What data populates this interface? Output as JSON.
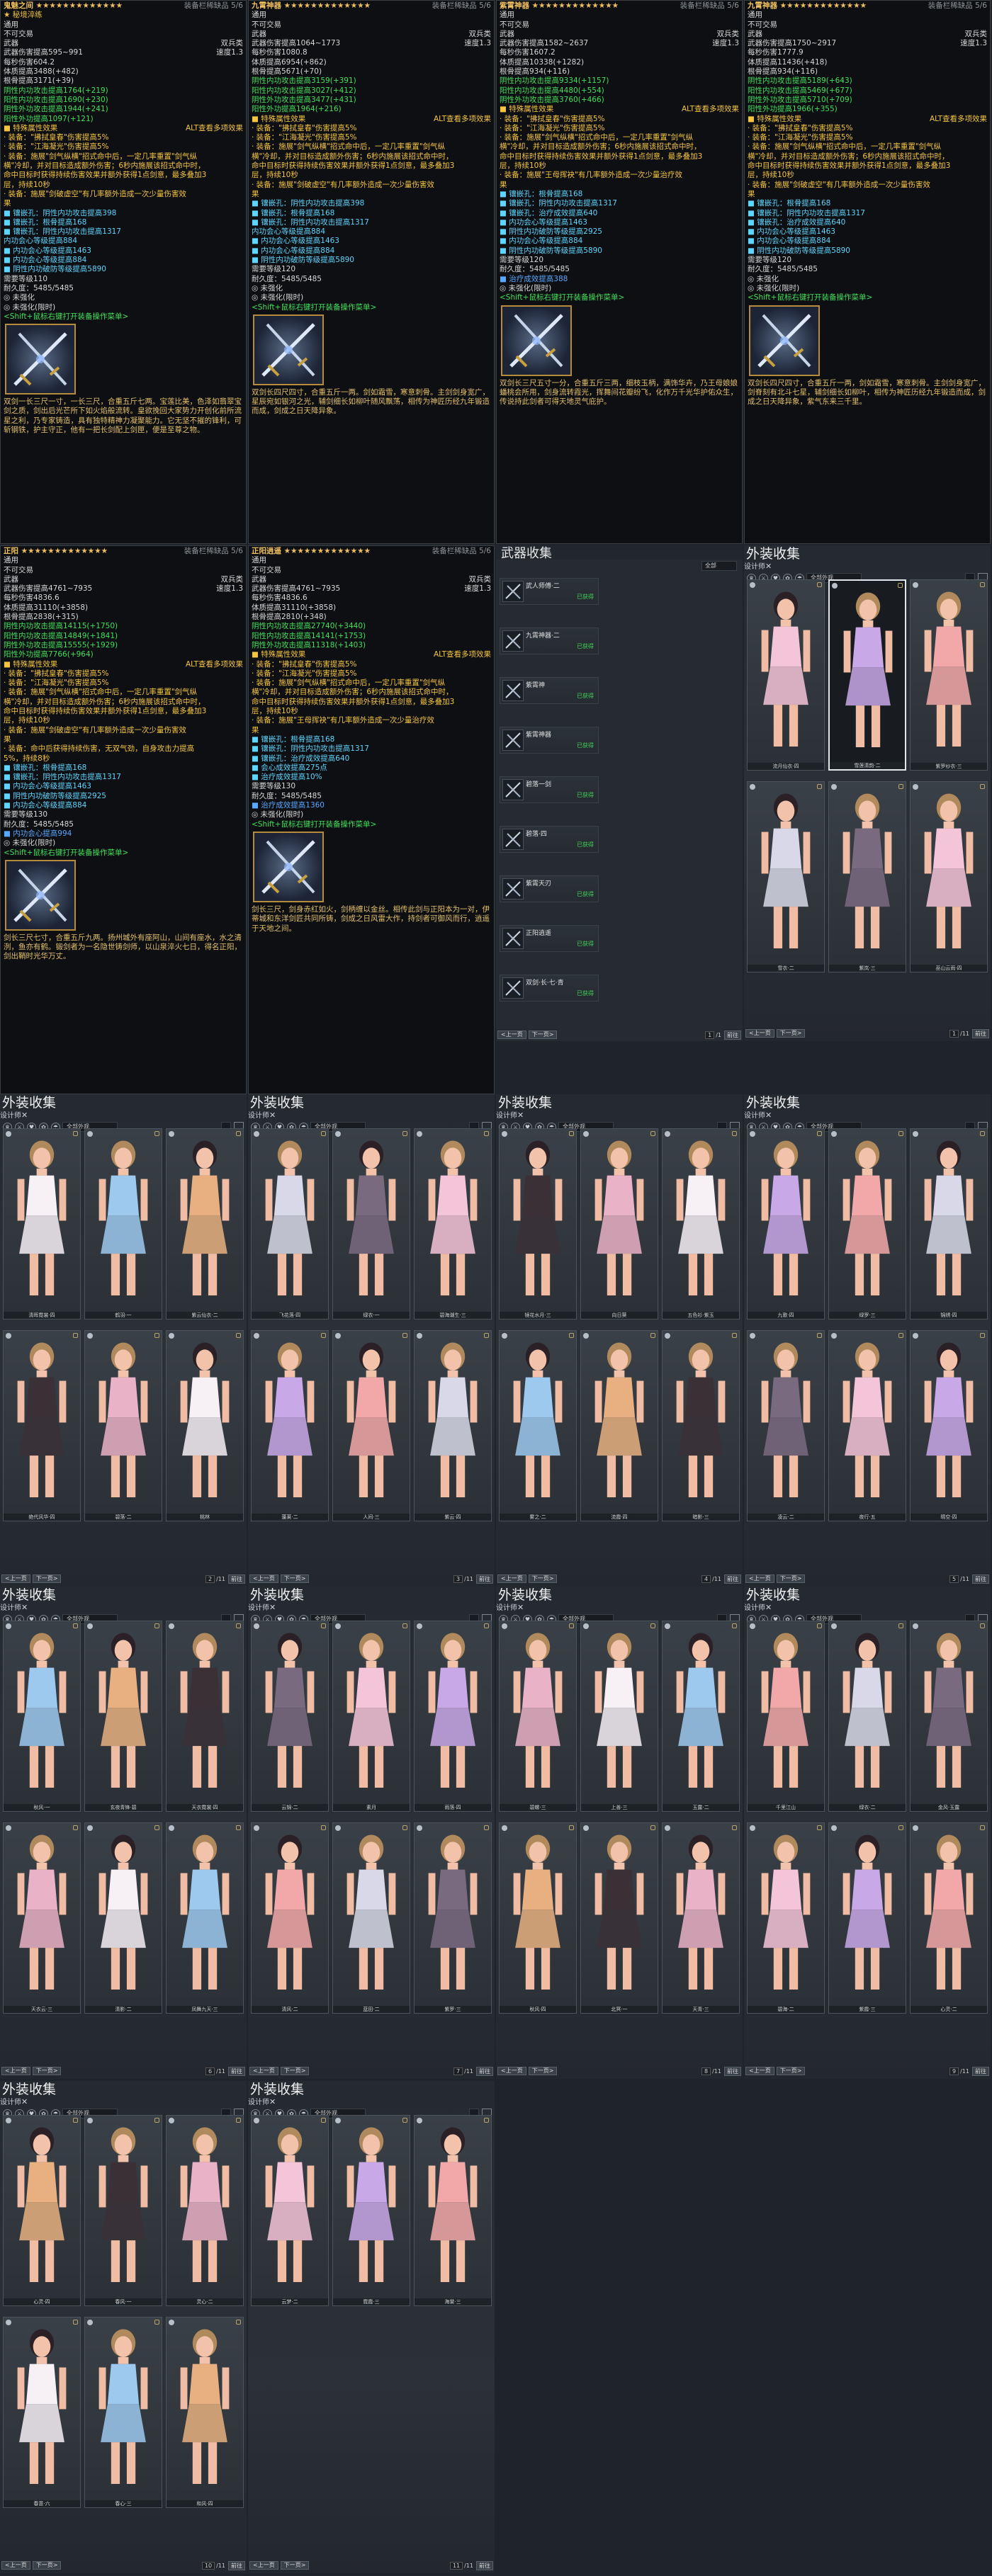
{
  "tooltips": [
    {
      "title": "鬼魅之间 ★★★★★★★★★★★★★",
      "stars": "★★★★★★★★★★★★",
      "right_tag": "装备栏稀缺品 5/6",
      "lines": [
        {
          "t": "★ 秘境淬练",
          "c": "gold"
        },
        {
          "t": "通用",
          "c": ""
        },
        {
          "t": "不可交易",
          "c": ""
        },
        {
          "l": "武器",
          "r": "双兵类",
          "c": ""
        },
        {
          "l": "武器伤害提高595~991",
          "r": "速度1.3",
          "c": ""
        },
        {
          "t": "每秒伤害604.2",
          "c": ""
        },
        {
          "t": "体质提高3488(+482)",
          "c": ""
        },
        {
          "t": "根骨提高3171(+39)",
          "c": ""
        },
        {
          "t": "阴性内功攻击提高1764(+219)",
          "c": "green"
        },
        {
          "t": "阳性内功攻击提高1690(+230)",
          "c": "green"
        },
        {
          "t": "阴性外功攻击提高1944(+241)",
          "c": "green"
        },
        {
          "t": "阳性外功提高1097(+121)",
          "c": "green"
        },
        {
          "l": "■ 特殊属性效果",
          "r": "ALT查看多项效果",
          "c": "gold"
        },
        {
          "t": "· 装备：\"拂拭皇春\"伤害提高5%",
          "c": "gold"
        },
        {
          "t": "· 装备：\"江海凝光\"伤害提高5%",
          "c": "gold"
        },
        {
          "t": "· 装备：施展\"剑气纵横\"招式命中后，一定几率重置\"剑气纵",
          "c": "gold"
        },
        {
          "t": "横\"冷却，并对目标造成额外伤害；6秒内施展该招式命中时，",
          "c": "gold"
        },
        {
          "t": "命中目标时获得持续伤害效果并额外获得1点剑意，最多叠加3",
          "c": "gold"
        },
        {
          "t": "层，持续10秒",
          "c": "gold"
        },
        {
          "t": "· 装备：施展\"剑破虚空\"有几率额外造成一次少量伤害效",
          "c": "gold"
        },
        {
          "t": "果",
          "c": "gold"
        },
        {
          "t": "■ 镶嵌孔：阴性内功攻击提高398",
          "c": "cyan"
        },
        {
          "t": "■ 镶嵌孔：根骨提高168",
          "c": "cyan"
        },
        {
          "t": "■ 镶嵌孔：阴性内功攻击提高1317",
          "c": "cyan"
        },
        {
          "t": "  内功会心等级提高884",
          "c": "cyan"
        },
        {
          "t": "■ 内功会心等级提高1463",
          "c": "cyan"
        },
        {
          "t": "■ 内功会心等级提高884",
          "c": "cyan"
        },
        {
          "t": "■ 阴性内功破防等级提高5890",
          "c": "cyan"
        },
        {
          "t": "需要等级110",
          "c": ""
        },
        {
          "t": "耐久度：5485/5485",
          "c": ""
        },
        {
          "t": "◎ 未强化",
          "c": ""
        },
        {
          "t": "◎ 未强化(限时)",
          "c": ""
        },
        {
          "t": "<Shift+鼠标右键打开装备操作菜单>",
          "c": "green"
        }
      ],
      "lore": "双剑一长三尺一寸，一长三尺，合重五斤七两。宝莲比美，色泽如翡翠宝剑之质，剑出后光芒所下如火焰般流转。皇欲挽回大家势力开创化前所流星之利，乃专家铸造，具有独特精神力凝聚能力。它无坚不摧的锋利，可斩钢铁，护主守正，他有一把长剑配上剑匣，便是至尊之物。"
    },
    {
      "title": "九霄神器 ★★★★★★★★★★★★★",
      "stars": "★★★★★★★★★★★★",
      "right_tag": "装备栏稀缺品 5/6",
      "lines": [
        {
          "t": "通用",
          "c": ""
        },
        {
          "t": "不可交易",
          "c": ""
        },
        {
          "l": "武器",
          "r": "双兵类",
          "c": ""
        },
        {
          "l": "武器伤害提高1064~1773",
          "r": "速度1.3",
          "c": ""
        },
        {
          "t": "每秒伤害1080.8",
          "c": ""
        },
        {
          "t": "体质提高6954(+862)",
          "c": ""
        },
        {
          "t": "根骨提高5671(+70)",
          "c": ""
        },
        {
          "t": "阴性内功攻击提高3159(+391)",
          "c": "green"
        },
        {
          "t": "阳性内功攻击提高3027(+412)",
          "c": "green"
        },
        {
          "t": "阴性外功攻击提高3477(+431)",
          "c": "green"
        },
        {
          "t": "阳性外功提高1964(+216)",
          "c": "green"
        },
        {
          "l": "■ 特殊属性效果",
          "r": "ALT查看多项效果",
          "c": "gold"
        },
        {
          "t": "· 装备：\"拂拭皇春\"伤害提高5%",
          "c": "gold"
        },
        {
          "t": "· 装备：\"江海凝光\"伤害提高5%",
          "c": "gold"
        },
        {
          "t": "· 装备：施展\"剑气纵横\"招式命中后，一定几率重置\"剑气纵",
          "c": "gold"
        },
        {
          "t": "横\"冷却，并对目标造成额外伤害；6秒内施展该招式命中时，",
          "c": "gold"
        },
        {
          "t": "命中目标时获得持续伤害效果并额外获得1点剑意，最多叠加3",
          "c": "gold"
        },
        {
          "t": "层，持续10秒",
          "c": "gold"
        },
        {
          "t": "· 装备：施展\"剑破虚空\"有几率额外造成一次少量伤害效",
          "c": "gold"
        },
        {
          "t": "果",
          "c": "gold"
        },
        {
          "t": "■ 镶嵌孔：阴性内功攻击提高398",
          "c": "cyan"
        },
        {
          "t": "■ 镶嵌孔：根骨提高168",
          "c": "cyan"
        },
        {
          "t": "■ 镶嵌孔：阴性内功攻击提高1317",
          "c": "cyan"
        },
        {
          "t": "  内功会心等级提高884",
          "c": "cyan"
        },
        {
          "t": "■ 内功会心等级提高1463",
          "c": "cyan"
        },
        {
          "t": "■ 内功会心等级提高884",
          "c": "cyan"
        },
        {
          "t": "■ 阴性内功破防等级提高5890",
          "c": "cyan"
        },
        {
          "t": "需要等级120",
          "c": ""
        },
        {
          "t": "耐久度：5485/5485",
          "c": ""
        },
        {
          "t": "◎ 未强化",
          "c": ""
        },
        {
          "t": "◎ 未强化(限时)",
          "c": ""
        },
        {
          "t": "<Shift+鼠标右键打开装备操作菜单>",
          "c": "green"
        }
      ],
      "lore": "双剑长四尺四寸，合重五斤一两。剑如霜雪，寒意刺骨。主剑剑身宽广，星辰宛如银河之光，辅剑细长如柳叶随风飘荡，相传为神匠历经九年锻造而成，剑成之日天降异象。"
    },
    {
      "title": "紫霄神器 ★★★★★★★★★★★★★",
      "stars": "★★★★★★★★★★★★",
      "right_tag": "装备栏稀缺品 5/6",
      "lines": [
        {
          "t": "通用",
          "c": ""
        },
        {
          "t": "不可交易",
          "c": ""
        },
        {
          "l": "武器",
          "r": "双兵类",
          "c": ""
        },
        {
          "l": "武器伤害提高1582~2637",
          "r": "速度1.3",
          "c": ""
        },
        {
          "t": "每秒伤害1607.2",
          "c": ""
        },
        {
          "t": "体质提高10338(+1282)",
          "c": ""
        },
        {
          "t": "根骨提高934(+116)",
          "c": ""
        },
        {
          "t": "阴性内功攻击提高9334(+1157)",
          "c": "green"
        },
        {
          "t": "阳性内功攻击提高4480(+554)",
          "c": "green"
        },
        {
          "t": "阴性外功攻击提高3760(+466)",
          "c": "green"
        },
        {
          "l": "■ 特殊属性效果",
          "r": "ALT查看多项效果",
          "c": "gold"
        },
        {
          "t": "· 装备：\"拂拭皇春\"伤害提高5%",
          "c": "gold"
        },
        {
          "t": "· 装备：\"江海凝光\"伤害提高5%",
          "c": "gold"
        },
        {
          "t": "· 装备：施展\"剑气纵横\"招式命中后，一定几率重置\"剑气纵",
          "c": "gold"
        },
        {
          "t": "横\"冷却，并对目标造成额外伤害；6秒内施展该招式命中时，",
          "c": "gold"
        },
        {
          "t": "命中目标时获得持续伤害效果并额外获得1点剑意，最多叠加3",
          "c": "gold"
        },
        {
          "t": "层，持续10秒",
          "c": "gold"
        },
        {
          "t": "· 装备：施展\"王母挥袂\"有几率额外造成一次少量治疗效",
          "c": "gold"
        },
        {
          "t": "果",
          "c": "gold"
        },
        {
          "t": "■ 镶嵌孔：根骨提高168",
          "c": "cyan"
        },
        {
          "t": "■ 镶嵌孔：阴性内功攻击提高1317",
          "c": "cyan"
        },
        {
          "t": "■ 镶嵌孔：治疗成效提高640",
          "c": "cyan"
        },
        {
          "t": "■ 内功会心等级提高1463",
          "c": "cyan"
        },
        {
          "t": "■ 阴性内功破防等级提高2925",
          "c": "cyan"
        },
        {
          "t": "■ 内功会心等级提高884",
          "c": "cyan"
        },
        {
          "t": "■ 阴性内功破防等级提高5890",
          "c": "cyan"
        },
        {
          "t": "需要等级120",
          "c": ""
        },
        {
          "t": "耐久度：5485/5485",
          "c": ""
        },
        {
          "t": "■ 治疗成效提高388",
          "c": "blue"
        },
        {
          "t": "◎ 未强化(限时)",
          "c": ""
        },
        {
          "t": "<Shift+鼠标右键打开装备操作菜单>",
          "c": "green"
        }
      ],
      "lore": "双剑长三尺五寸一分，合重五斤三两，细枝玉柄，满饰华卉，乃王母娘娘蟠桃会所用，剑身流转霞光，挥舞间花瓣纷飞，化作万千光华护佑众生，传说持此剑者可得天地灵气庇护。"
    },
    {
      "title": "九霄神器 ★★★★★★★★★★★★★",
      "stars": "★★★★★★★★★★★★",
      "right_tag": "装备栏稀缺品 5/6",
      "lines": [
        {
          "t": "通用",
          "c": ""
        },
        {
          "t": "不可交易",
          "c": ""
        },
        {
          "l": "武器",
          "r": "双兵类",
          "c": ""
        },
        {
          "l": "武器伤害提高1750~2917",
          "r": "速度1.3",
          "c": ""
        },
        {
          "t": "每秒伤害1777.9",
          "c": ""
        },
        {
          "t": "体质提高11436(+418)",
          "c": ""
        },
        {
          "t": "根骨提高934(+116)",
          "c": ""
        },
        {
          "t": "阴性内功攻击提高5189(+643)",
          "c": "green"
        },
        {
          "t": "阳性内功攻击提高5469(+677)",
          "c": "green"
        },
        {
          "t": "阴性外功攻击提高5710(+709)",
          "c": "green"
        },
        {
          "t": "阳性外功提高1966(+355)",
          "c": "green"
        },
        {
          "l": "■ 特殊属性效果",
          "r": "ALT查看多项效果",
          "c": "gold"
        },
        {
          "t": "· 装备：\"拂拭皇春\"伤害提高5%",
          "c": "gold"
        },
        {
          "t": "· 装备：\"江海凝光\"伤害提高5%",
          "c": "gold"
        },
        {
          "t": "· 装备：施展\"剑气纵横\"招式命中后，一定几率重置\"剑气纵",
          "c": "gold"
        },
        {
          "t": "横\"冷却，并对目标造成额外伤害；6秒内施展该招式命中时，",
          "c": "gold"
        },
        {
          "t": "命中目标时获得持续伤害效果并额外获得1点剑意，最多叠加3",
          "c": "gold"
        },
        {
          "t": "层，持续10秒",
          "c": "gold"
        },
        {
          "t": "· 装备：施展\"剑破虚空\"有几率额外造成一次少量伤害效",
          "c": "gold"
        },
        {
          "t": "果",
          "c": "gold"
        },
        {
          "t": "■ 镶嵌孔：根骨提高168",
          "c": "cyan"
        },
        {
          "t": "■ 镶嵌孔：阴性内功攻击提高1317",
          "c": "cyan"
        },
        {
          "t": "■ 镶嵌孔：治疗成效提高640",
          "c": "cyan"
        },
        {
          "t": "■ 内功会心等级提高1463",
          "c": "cyan"
        },
        {
          "t": "■ 内功会心等级提高884",
          "c": "cyan"
        },
        {
          "t": "■ 阴性内功破防等级提高5890",
          "c": "cyan"
        },
        {
          "t": "需要等级120",
          "c": ""
        },
        {
          "t": "耐久度：5485/5485",
          "c": ""
        },
        {
          "t": "◎ 未强化",
          "c": ""
        },
        {
          "t": "◎ 未强化(限时)",
          "c": ""
        },
        {
          "t": "<Shift+鼠标右键打开装备操作菜单>",
          "c": "green"
        }
      ],
      "lore": "双剑长四尺四寸，合重五斤一两，剑如霜雪，寒意刺骨。主剑剑身宽广，剑脊刻有北斗七星，辅剑细长如柳叶，相传为神匠历经九年锻造而成，剑成之日天降异象，紫气东来三千里。"
    },
    {
      "title": "正阳 ★★★★★★★★★★★★★",
      "stars": "★★★★★★★★★★★★",
      "right_tag": "装备栏稀缺品 5/6",
      "lines": [
        {
          "t": "通用",
          "c": ""
        },
        {
          "t": "不可交易",
          "c": ""
        },
        {
          "l": "武器",
          "r": "双兵类",
          "c": ""
        },
        {
          "l": "武器伤害提高4761~7935",
          "r": "速度1.3",
          "c": ""
        },
        {
          "t": "每秒伤害4836.6",
          "c": ""
        },
        {
          "t": "体质提高31110(+3858)",
          "c": ""
        },
        {
          "t": "根骨提高2838(+315)",
          "c": ""
        },
        {
          "t": "阴性内功攻击提高14115(+1750)",
          "c": "green"
        },
        {
          "t": "阳性内功攻击提高14849(+1841)",
          "c": "green"
        },
        {
          "t": "阴性外功攻击提高15555(+1929)",
          "c": "green"
        },
        {
          "t": "阳性外功提高7766(+964)",
          "c": "green"
        },
        {
          "l": "■ 特殊属性效果",
          "r": "ALT查看多项效果",
          "c": "gold"
        },
        {
          "t": "· 装备：\"拂拭皇春\"伤害提高5%",
          "c": "gold"
        },
        {
          "t": "· 装备：\"江海凝光\"伤害提高5%",
          "c": "gold"
        },
        {
          "t": "· 装备：施展\"剑气纵横\"招式命中后，一定几率重置\"剑气纵",
          "c": "gold"
        },
        {
          "t": "横\"冷却，并对目标造成额外伤害；6秒内施展该招式命中时，",
          "c": "gold"
        },
        {
          "t": "命中目标时获得持续伤害效果并额外获得1点剑意，最多叠加3",
          "c": "gold"
        },
        {
          "t": "层，持续10秒",
          "c": "gold"
        },
        {
          "t": "· 装备：施展\"剑破虚空\"有几率额外造成一次少量伤害效",
          "c": "gold"
        },
        {
          "t": "果",
          "c": "gold"
        },
        {
          "t": "· 装备：命中后获得持续伤害，无双气劲，自身攻击力提高",
          "c": "gold"
        },
        {
          "t": "5%，持续8秒",
          "c": "gold"
        },
        {
          "t": "■ 镶嵌孔：根骨提高168",
          "c": "cyan"
        },
        {
          "t": "■ 镶嵌孔：阴性内功攻击提高1317",
          "c": "cyan"
        },
        {
          "t": "■ 内功会心等级提高1463",
          "c": "cyan"
        },
        {
          "t": "■ 阴性内功破防等级提高2925",
          "c": "cyan"
        },
        {
          "t": "■ 内功会心等级提高884",
          "c": "cyan"
        },
        {
          "t": "需要等级130",
          "c": ""
        },
        {
          "t": "耐久度：5485/5485",
          "c": ""
        },
        {
          "t": "■ 内功会心提高994",
          "c": "blue"
        },
        {
          "t": "◎ 未强化(限时)",
          "c": ""
        },
        {
          "t": "<Shift+鼠标右键打开装备操作菜单>",
          "c": "green"
        }
      ],
      "lore": "剑长三尺七寸，合重五斤九两。扬州城外有座阿山，山间有座水，水之清洌，鱼亦有鹤。锻剑者为一名隐世铸剑师，以山泉淬火七日，得名正阳，剑出鞘时光华万丈。"
    },
    {
      "title": "正阳逍遥 ★★★★★★★★★★★★★",
      "stars": "★★★★★★★★★★★★",
      "right_tag": "装备栏稀缺品 5/6",
      "lines": [
        {
          "t": "通用",
          "c": ""
        },
        {
          "t": "不可交易",
          "c": ""
        },
        {
          "l": "武器",
          "r": "双兵类",
          "c": ""
        },
        {
          "l": "武器伤害提高4761~7935",
          "r": "速度1.3",
          "c": ""
        },
        {
          "t": "每秒伤害4836.6",
          "c": ""
        },
        {
          "t": "体质提高31110(+3858)",
          "c": ""
        },
        {
          "t": "根骨提高2810(+348)",
          "c": ""
        },
        {
          "t": "阴性内功攻击提高27740(+3440)",
          "c": "green"
        },
        {
          "t": "阳性内功攻击提高14141(+1753)",
          "c": "green"
        },
        {
          "t": "阴性外功攻击提高11318(+1403)",
          "c": "green"
        },
        {
          "l": "■ 特殊属性效果",
          "r": "ALT查看多项效果",
          "c": "gold"
        },
        {
          "t": "· 装备：\"拂拭皇春\"伤害提高5%",
          "c": "gold"
        },
        {
          "t": "· 装备：\"江海凝光\"伤害提高5%",
          "c": "gold"
        },
        {
          "t": "· 装备：施展\"剑气纵横\"招式命中后，一定几率重置\"剑气纵",
          "c": "gold"
        },
        {
          "t": "横\"冷却，并对目标造成额外伤害；6秒内施展该招式命中时，",
          "c": "gold"
        },
        {
          "t": "命中目标时获得持续伤害效果并额外获得1点剑意，最多叠加3",
          "c": "gold"
        },
        {
          "t": "层，持续10秒",
          "c": "gold"
        },
        {
          "t": "· 装备：施展\"王母挥袂\"有几率额外造成一次少量治疗效",
          "c": "gold"
        },
        {
          "t": "果",
          "c": "gold"
        },
        {
          "t": "■ 镶嵌孔：根骨提高168",
          "c": "cyan"
        },
        {
          "t": "■ 镶嵌孔：阴性内功攻击提高1317",
          "c": "cyan"
        },
        {
          "t": "■ 镶嵌孔：治疗成效提高640",
          "c": "cyan"
        },
        {
          "t": "■ 会心成效提高275点",
          "c": "cyan"
        },
        {
          "t": "■ 治疗成效提高10%",
          "c": "cyan"
        },
        {
          "t": "需要等级130",
          "c": ""
        },
        {
          "t": "耐久度：5485/5485",
          "c": ""
        },
        {
          "t": "■ 治疗成效提高1360",
          "c": "blue"
        },
        {
          "t": "◎ 未强化(限时)",
          "c": ""
        },
        {
          "t": "<Shift+鼠标右键打开装备操作菜单>",
          "c": "green"
        }
      ],
      "lore": "剑长三尺，剑身赤红如火，剑柄缠以金丝。相传此剑与正阳本为一对，伊蒂城和东洋剑匠共同所铸，剑成之日风雷大作，持剑者可御风而行，逍遥于天地之间。"
    }
  ],
  "weapon_list": {
    "title": "武器收集",
    "filter": "全部",
    "items": [
      {
        "name": "武人师傅·二",
        "tag": "已获得"
      },
      {
        "name": "九霄神器·二",
        "tag": "已获得"
      },
      {
        "name": "紫霄神",
        "tag": "已获得"
      },
      {
        "name": "紫霄神器",
        "tag": "已获得"
      },
      {
        "name": "碧落一剑",
        "tag": "已获得"
      },
      {
        "name": "碧落·四",
        "tag": "已获得"
      },
      {
        "name": "紫霄天刃",
        "tag": "已获得"
      },
      {
        "name": "正阳逍遥",
        "tag": "已获得"
      },
      {
        "name": "双剑·长·七·青",
        "tag": "已获得"
      }
    ],
    "prev": "<上一页",
    "next": "下一页>",
    "page": "1",
    "total": "/1",
    "confirm": "前往"
  },
  "collections": [
    {
      "title": "外装收集",
      "filter": "全部外观",
      "vip": "设计师",
      "page": "1",
      "total": "/11",
      "cards": [
        "流月仙衣·四",
        "雪莲清韵·二",
        "紫罗纱衣·三",
        "雪衣·二",
        "紫岚·三",
        "巫山云雨·四"
      ]
    },
    {
      "title": "外装收集",
      "filter": "全部外观",
      "vip": "设计师",
      "page": "2",
      "total": "/11",
      "cards": [
        "清晖霓裳·四",
        "鹤羽·一",
        "紫云仙衣·二",
        "绝代风华·四",
        "碧落·二",
        "桃林"
      ]
    },
    {
      "title": "外装收集",
      "filter": "全部外观",
      "vip": "设计师",
      "page": "3",
      "total": "/11",
      "cards": [
        "飞花落·四",
        "绿衣·一",
        "碧海潮生·三",
        "蓬莱·二",
        "人间·三",
        "紫云·四"
      ]
    },
    {
      "title": "外装收集",
      "filter": "全部外观",
      "vip": "设计师",
      "page": "4",
      "total": "/11",
      "cards": [
        "镜花水月·三",
        "向日葵",
        "五色衫·紫玉",
        "雾之·二",
        "流霞·四",
        "暗影·三"
      ]
    },
    {
      "title": "外装收集",
      "filter": "全部外观",
      "vip": "设计师",
      "page": "5",
      "total": "/11",
      "cards": [
        "九歌·四",
        "绿罗·三",
        "锦绣·四",
        "凌云·二",
        "夜行·五",
        "晴空·四"
      ]
    },
    {
      "title": "外装收集",
      "filter": "全部外观",
      "vip": "设计师",
      "page": "6",
      "total": "/11",
      "cards": [
        "秋风·一",
        "玄夜青锋·碧",
        "天衣霓裳·四",
        "天衣云·三",
        "清影·二",
        "凤舞九天·三"
      ]
    },
    {
      "title": "外装收集",
      "filter": "全部外观",
      "vip": "设计师",
      "page": "7",
      "total": "/11",
      "cards": [
        "云锦·二",
        "素月",
        "雨落·四",
        "清风·二",
        "蓝田·二",
        "紫罗·三"
      ]
    },
    {
      "title": "外装收集",
      "filter": "全部外观",
      "vip": "设计师",
      "page": "8",
      "total": "/11",
      "cards": [
        "碧螺·三",
        "上善·三",
        "玉露·二",
        "秋风·四",
        "北冥·一",
        "天青·三"
      ]
    },
    {
      "title": "外装收集",
      "filter": "全部外观",
      "vip": "设计师",
      "page": "9",
      "total": "/11",
      "cards": [
        "千里江山",
        "绿衣·二",
        "金风·玉露",
        "碧海·二",
        "紫霞·三",
        "心灵·二"
      ]
    },
    {
      "title": "外装收集",
      "filter": "全部外观",
      "vip": "设计师",
      "page": "10",
      "total": "/11",
      "cards": [
        "心灵·四",
        "春风·一",
        "灵心·二",
        "春意·六",
        "春心·三",
        "和风·四"
      ]
    },
    {
      "title": "外装收集",
      "filter": "全部外观",
      "vip": "设计师",
      "page": "11",
      "total": "/11",
      "cards": [
        "云梦·二",
        "霓霞·三",
        "海棠·三"
      ]
    }
  ],
  "pager": {
    "prev": "<上一页",
    "next": "下一页>",
    "confirm": "前往"
  },
  "colors": {
    "gold": "#f5c542",
    "green": "#42e05a",
    "cyan": "#5fd6ff",
    "panel": "#0d0f12"
  }
}
